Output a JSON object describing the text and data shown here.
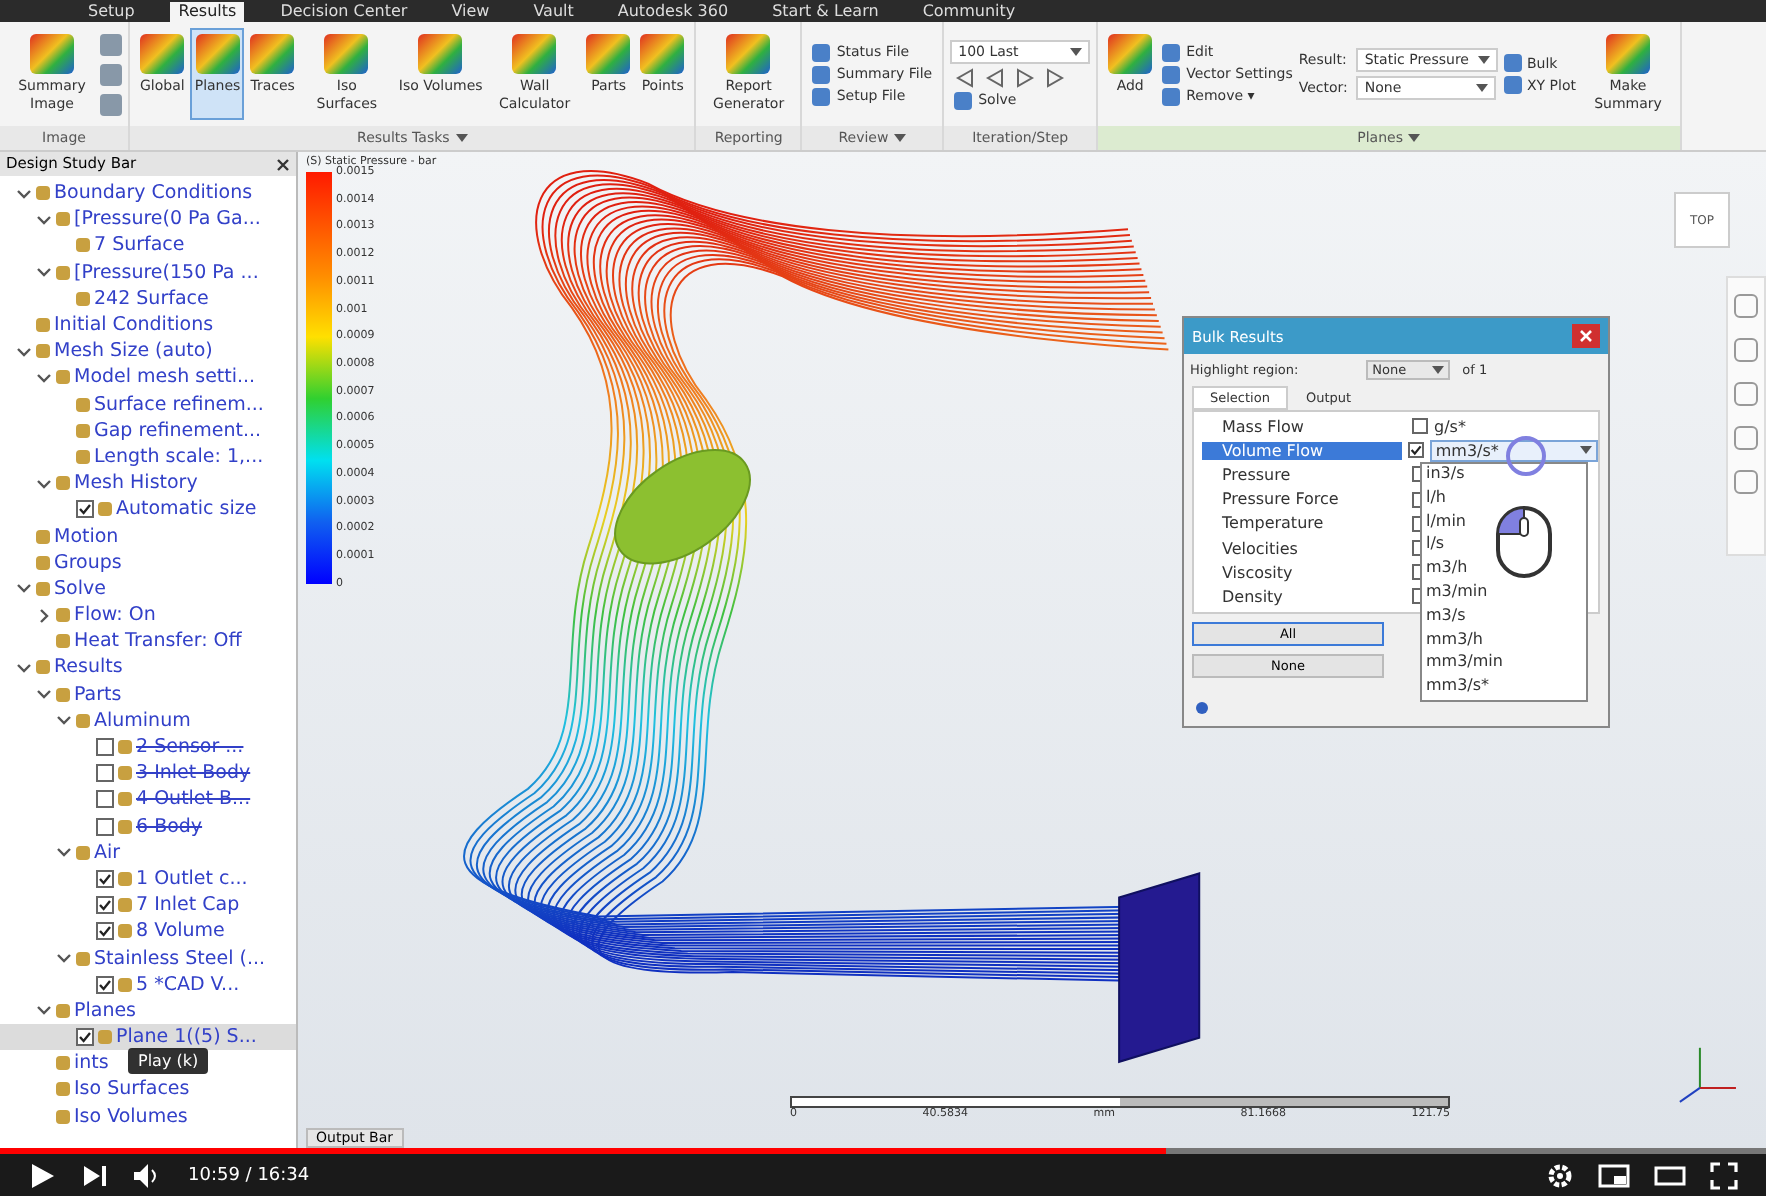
{
  "ribbon_tabs": [
    {
      "label": "Setup",
      "selected": false
    },
    {
      "label": "Results",
      "selected": true
    },
    {
      "label": "Decision Center",
      "selected": false
    },
    {
      "label": "View",
      "selected": false
    },
    {
      "label": "Vault",
      "selected": false
    },
    {
      "label": "Autodesk 360",
      "selected": false
    },
    {
      "label": "Start & Learn",
      "selected": false
    },
    {
      "label": "Community",
      "selected": false
    }
  ],
  "ribbon_groups": [
    {
      "label": "Image",
      "has_menu": false,
      "highlight": false,
      "columns": [
        [
          {
            "kind": "large",
            "label": "Summary Image",
            "selected": false
          }
        ],
        [
          {
            "kind": "icon_stack"
          }
        ]
      ]
    },
    {
      "label": "Results Tasks",
      "has_menu": true,
      "highlight": false,
      "columns": [
        [
          {
            "kind": "large",
            "label": "Global",
            "selected": false
          }
        ],
        [
          {
            "kind": "large",
            "label": "Planes",
            "selected": true
          }
        ],
        [
          {
            "kind": "large",
            "label": "Traces",
            "selected": false
          }
        ],
        [
          {
            "kind": "large",
            "label": "Iso Surfaces",
            "selected": false
          }
        ],
        [
          {
            "kind": "large",
            "label": "Iso Volumes",
            "selected": false
          }
        ],
        [
          {
            "kind": "large",
            "label": "Wall Calculator",
            "selected": false
          }
        ],
        [
          {
            "kind": "large",
            "label": "Parts",
            "selected": false
          }
        ],
        [
          {
            "kind": "large",
            "label": "Points",
            "selected": false
          }
        ]
      ]
    },
    {
      "label": "Reporting",
      "has_menu": false,
      "highlight": false,
      "columns": [
        [
          {
            "kind": "large",
            "label": "Report Generator",
            "selected": false
          }
        ]
      ]
    },
    {
      "label": "Review",
      "has_menu": true,
      "highlight": false,
      "columns": [
        [
          {
            "kind": "small",
            "label": "Status File"
          },
          {
            "kind": "small",
            "label": "Summary File"
          },
          {
            "kind": "small",
            "label": "Setup File"
          }
        ]
      ]
    },
    {
      "label": "Iteration/Step",
      "has_menu": false,
      "highlight": false,
      "columns": [
        [
          {
            "kind": "field",
            "value": "100 Last"
          },
          {
            "kind": "stepper"
          },
          {
            "kind": "small",
            "label": "Solve"
          }
        ]
      ]
    },
    {
      "label": "Planes",
      "has_menu": true,
      "highlight": true,
      "columns": [
        [
          {
            "kind": "large",
            "label": "Add",
            "selected": false
          }
        ],
        [
          {
            "kind": "small",
            "label": "Edit"
          },
          {
            "kind": "small",
            "label": "Vector Settings"
          },
          {
            "kind": "small",
            "label": "Remove ▾"
          }
        ],
        [
          {
            "kind": "field",
            "label": "Result:",
            "value": "Static Pressure"
          },
          {
            "kind": "field",
            "label": "Vector:",
            "value": "None"
          }
        ],
        [
          {
            "kind": "small",
            "label": "Bulk"
          },
          {
            "kind": "small",
            "label": "XY Plot"
          }
        ],
        [
          {
            "kind": "large",
            "label": "Make Summary",
            "selected": false
          }
        ]
      ]
    }
  ],
  "sidebar": {
    "title": "Design Study Bar",
    "tree": [
      {
        "label": "Boundary Conditions",
        "expanded": true,
        "selected": false,
        "children": [
          {
            "label": "[Pressure(0 Pa Ga...",
            "expanded": true,
            "selected": false,
            "children": [
              {
                "label": "7 Surface",
                "selected": false
              }
            ]
          },
          {
            "label": "[Pressure(150 Pa ...",
            "expanded": true,
            "selected": false,
            "children": [
              {
                "label": "242 Surface",
                "selected": false
              }
            ]
          }
        ]
      },
      {
        "label": "Initial Conditions",
        "selected": false
      },
      {
        "label": "Mesh Size (auto)",
        "expanded": true,
        "selected": false,
        "children": [
          {
            "label": "Model mesh setti...",
            "expanded": true,
            "selected": false,
            "children": [
              {
                "label": "Surface refinem...",
                "selected": false
              },
              {
                "label": "Gap refinement...",
                "selected": false
              },
              {
                "label": "Length scale: 1,...",
                "selected": false
              }
            ]
          },
          {
            "label": "Mesh History",
            "expanded": true,
            "selected": false,
            "children": [
              {
                "label": "Automatic size",
                "checked": true,
                "selected": false
              }
            ]
          }
        ]
      },
      {
        "label": "Motion",
        "selected": false
      },
      {
        "label": "Groups",
        "selected": false
      },
      {
        "label": "Solve",
        "expanded": true,
        "selected": false,
        "children": [
          {
            "label": "Flow: On",
            "expanded": false,
            "selected": false
          },
          {
            "label": "Heat Transfer: Off",
            "selected": false
          }
        ]
      },
      {
        "label": "Results",
        "expanded": true,
        "selected": false,
        "children": [
          {
            "label": "Parts",
            "expanded": true,
            "selected": false,
            "children": [
              {
                "label": "Aluminum",
                "expanded": true,
                "selected": false,
                "children": [
                  {
                    "label": "2 Sensor ...",
                    "checked": false,
                    "hidden": true,
                    "selected": false
                  },
                  {
                    "label": "3 Inlet Body",
                    "checked": false,
                    "hidden": true,
                    "selected": false
                  },
                  {
                    "label": "4 Outlet B...",
                    "checked": false,
                    "hidden": true,
                    "selected": false
                  },
                  {
                    "label": "6 Body",
                    "checked": false,
                    "hidden": true,
                    "selected": false
                  }
                ]
              },
              {
                "label": "Air",
                "expanded": true,
                "selected": false,
                "children": [
                  {
                    "label": "1 Outlet c...",
                    "checked": true,
                    "hidden": false,
                    "selected": false
                  },
                  {
                    "label": "7 Inlet Cap",
                    "checked": true,
                    "hidden": false,
                    "selected": false
                  },
                  {
                    "label": "8 Volume",
                    "checked": true,
                    "hidden": false,
                    "selected": false
                  }
                ]
              },
              {
                "label": "Stainless Steel (...",
                "expanded": true,
                "selected": false,
                "children": [
                  {
                    "label": "5 *CAD V...",
                    "checked": true,
                    "hidden": false,
                    "selected": false
                  }
                ]
              }
            ]
          },
          {
            "label": "Planes",
            "expanded": true,
            "selected": false,
            "children": [
              {
                "label": "Plane 1((5) S...",
                "checked": true,
                "selected": true
              }
            ]
          },
          {
            "label": "ints",
            "selected": false,
            "tooltip_here": true
          },
          {
            "label": "Iso Surfaces",
            "selected": false
          },
          {
            "label": "Iso Volumes",
            "selected": false
          }
        ]
      }
    ]
  },
  "legend": {
    "title": "(S) Static Pressure - bar",
    "ticks": [
      "0.0015",
      "0.0014",
      "0.0013",
      "0.0012",
      "0.0011",
      "0.001",
      "0.0009",
      "0.0008",
      "0.0007",
      "0.0006",
      "0.0005",
      "0.0004",
      "0.0003",
      "0.0002",
      "0.0001",
      "0"
    ]
  },
  "view_cube": "TOP",
  "scale_bar": [
    "0",
    "40.5834",
    "mm",
    "81.1668",
    "121.75"
  ],
  "output_bar": "Output Bar",
  "bulk_results": {
    "title": "Bulk Results",
    "highlight_label": "Highlight region:",
    "highlight_value": "None",
    "highlight_suffix": "of 1",
    "tabs": [
      {
        "label": "Selection",
        "selected": true
      },
      {
        "label": "Output",
        "selected": false
      }
    ],
    "rows": [
      {
        "name": "Mass Flow",
        "checked": false,
        "selected": false,
        "unit": "g/s*"
      },
      {
        "name": "Volume Flow",
        "checked": true,
        "selected": true,
        "unit": "mm3/s*"
      },
      {
        "name": "Pressure",
        "checked": false,
        "selected": false
      },
      {
        "name": "Pressure Force",
        "checked": false,
        "selected": false
      },
      {
        "name": "Temperature",
        "checked": false,
        "selected": false
      },
      {
        "name": "Velocities",
        "checked": false,
        "selected": false
      },
      {
        "name": "Viscosity",
        "checked": false,
        "selected": false
      },
      {
        "name": "Density",
        "checked": false,
        "selected": false
      }
    ],
    "unit_options": [
      {
        "label": "in3/s",
        "selected": false
      },
      {
        "label": "l/h",
        "selected": false
      },
      {
        "label": "l/min",
        "selected": false
      },
      {
        "label": "l/s",
        "selected": false
      },
      {
        "label": "m3/h",
        "selected": false
      },
      {
        "label": "m3/min",
        "selected": false
      },
      {
        "label": "m3/s",
        "selected": false
      },
      {
        "label": "mm3/h",
        "selected": false
      },
      {
        "label": "mm3/min",
        "selected": false
      },
      {
        "label": "mm3/s*",
        "selected": false
      }
    ],
    "buttons": [
      "All",
      "None"
    ]
  },
  "video": {
    "tooltip": "Play (k)",
    "time": "10:59 / 16:34",
    "progress": {
      "level": 0.66
    }
  }
}
